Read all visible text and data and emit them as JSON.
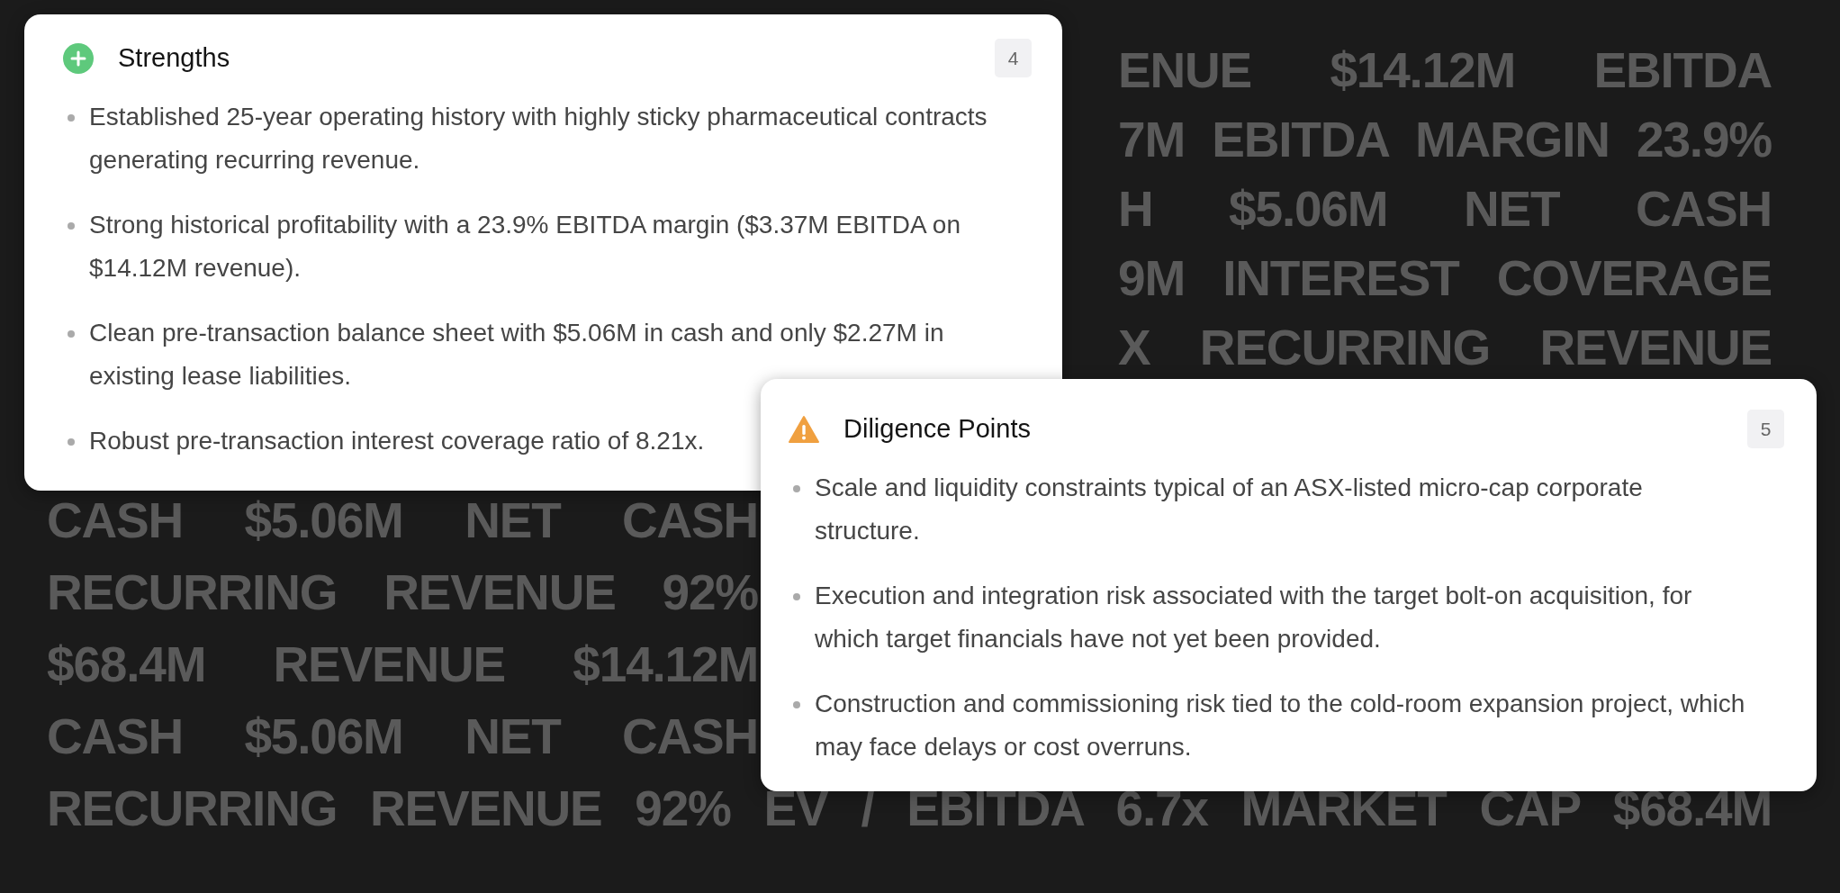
{
  "background_text": {
    "upper_lines": [
      "ENUE $14.12M EBITDA",
      "7M EBITDA MARGIN 23.9%",
      "H $5.06M NET CASH",
      "9M INTEREST COVERAGE",
      "X RECURRING REVENUE"
    ],
    "lower_lines": [
      "CASH $5.06M NET CASH",
      "RECURRING REVENUE 92%",
      "$68.4M REVENUE $14.12M",
      "CASH $5.06M NET CASH"
    ],
    "bottom_lines": [
      "RECURRING REVENUE 92% EV / EBITDA 6.7x MARKET CAP $68.4M"
    ]
  },
  "cards": [
    {
      "kind": "strength",
      "title": "Strengths",
      "count": "4",
      "items": [
        "Established 25-year operating history with highly sticky pharmaceutical contracts generating recurring revenue.",
        "Strong historical profitability with a 23.9% EBITDA margin ($3.37M EBITDA on $14.12M revenue).",
        "Clean pre-transaction balance sheet with $5.06M in cash and only $2.27M in existing lease liabilities.",
        "Robust pre-transaction interest coverage ratio of 8.21x."
      ]
    },
    {
      "kind": "diligence",
      "title": "Diligence Points",
      "count": "5",
      "items": [
        "Scale and liquidity constraints typical of an ASX-listed micro-cap corporate structure.",
        "Execution and integration risk associated with the target bolt-on acquisition, for which target financials have not yet been provided.",
        "Construction and commissioning risk tied to the cold-room expansion project, which may face delays or cost overruns."
      ]
    }
  ]
}
